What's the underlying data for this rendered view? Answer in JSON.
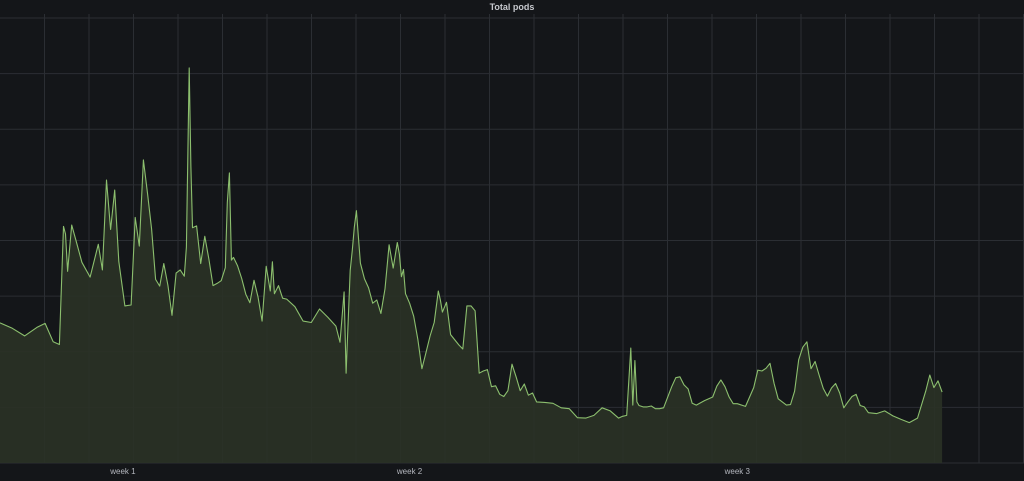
{
  "panel": {
    "title": "Total pods"
  },
  "colors": {
    "background": "#141619",
    "grid": "#2b2e33",
    "line": "#8cbf6e",
    "fill": "#2a3226"
  },
  "chart_data": {
    "type": "area",
    "title": "Total pods",
    "xlabel": "",
    "ylabel": "",
    "xlim": [
      0,
      25
    ],
    "ylim": [
      0,
      100
    ],
    "grid": true,
    "legend": "none",
    "x_tick_labels": [
      {
        "x": 3,
        "label": "week 1"
      },
      {
        "x": 10,
        "label": "week 2"
      },
      {
        "x": 18,
        "label": "week 3"
      }
    ],
    "series": [
      {
        "values": [
          [
            0.0,
            31.2
          ],
          [
            0.3,
            30.0
          ],
          [
            0.6,
            28.3
          ],
          [
            0.9,
            30.2
          ],
          [
            1.1,
            31.1
          ],
          [
            1.3,
            27.0
          ],
          [
            1.45,
            26.4
          ],
          [
            1.55,
            52.7
          ],
          [
            1.6,
            51.0
          ],
          [
            1.65,
            42.7
          ],
          [
            1.75,
            53.0
          ],
          [
            1.85,
            49.7
          ],
          [
            2.0,
            44.7
          ],
          [
            2.2,
            41.4
          ],
          [
            2.4,
            48.7
          ],
          [
            2.5,
            43.0
          ],
          [
            2.6,
            63.0
          ],
          [
            2.7,
            52.0
          ],
          [
            2.8,
            60.8
          ],
          [
            2.9,
            44.9
          ],
          [
            3.05,
            35.0
          ],
          [
            3.2,
            35.2
          ],
          [
            3.3,
            54.7
          ],
          [
            3.4,
            48.3
          ],
          [
            3.5,
            67.5
          ],
          [
            3.6,
            60.1
          ],
          [
            3.7,
            52.1
          ],
          [
            3.8,
            40.9
          ],
          [
            3.9,
            39.4
          ],
          [
            4.0,
            44.4
          ],
          [
            4.1,
            39.6
          ],
          [
            4.2,
            32.9
          ],
          [
            4.3,
            42.3
          ],
          [
            4.4,
            43.0
          ],
          [
            4.5,
            41.6
          ],
          [
            4.55,
            48.1
          ],
          [
            4.62,
            88.0
          ],
          [
            4.66,
            66.0
          ],
          [
            4.7,
            52.4
          ],
          [
            4.8,
            52.8
          ],
          [
            4.9,
            44.4
          ],
          [
            5.0,
            50.5
          ],
          [
            5.1,
            45.4
          ],
          [
            5.2,
            39.5
          ],
          [
            5.3,
            40.0
          ],
          [
            5.4,
            40.6
          ],
          [
            5.5,
            43.5
          ],
          [
            5.55,
            58.0
          ],
          [
            5.6,
            64.6
          ],
          [
            5.65,
            45.2
          ],
          [
            5.7,
            45.8
          ],
          [
            5.8,
            43.9
          ],
          [
            5.9,
            41.1
          ],
          [
            6.0,
            37.6
          ],
          [
            6.1,
            35.7
          ],
          [
            6.2,
            40.7
          ],
          [
            6.3,
            37.0
          ],
          [
            6.4,
            31.6
          ],
          [
            6.5,
            43.8
          ],
          [
            6.6,
            38.3
          ],
          [
            6.65,
            44.8
          ],
          [
            6.7,
            37.7
          ],
          [
            6.8,
            39.5
          ],
          [
            6.9,
            36.7
          ],
          [
            7.0,
            36.5
          ],
          [
            7.2,
            34.8
          ],
          [
            7.4,
            31.6
          ],
          [
            7.6,
            31.3
          ],
          [
            7.8,
            34.3
          ],
          [
            8.0,
            32.5
          ],
          [
            8.2,
            30.5
          ],
          [
            8.3,
            26.9
          ],
          [
            8.4,
            38.1
          ],
          [
            8.45,
            20.0
          ],
          [
            8.55,
            42.9
          ],
          [
            8.6,
            47.4
          ],
          [
            8.65,
            52.5
          ],
          [
            8.7,
            56.2
          ],
          [
            8.8,
            44.5
          ],
          [
            8.9,
            41.0
          ],
          [
            9.0,
            39.0
          ],
          [
            9.1,
            35.6
          ],
          [
            9.2,
            36.3
          ],
          [
            9.3,
            33.3
          ],
          [
            9.4,
            38.8
          ],
          [
            9.5,
            48.6
          ],
          [
            9.6,
            43.4
          ],
          [
            9.7,
            49.1
          ],
          [
            9.75,
            46.5
          ],
          [
            9.8,
            41.5
          ],
          [
            9.85,
            43.1
          ],
          [
            9.9,
            37.7
          ],
          [
            10.0,
            35.6
          ],
          [
            10.1,
            32.7
          ],
          [
            10.2,
            27.6
          ],
          [
            10.3,
            21.0
          ],
          [
            10.4,
            24.6
          ],
          [
            10.5,
            28.3
          ],
          [
            10.6,
            31.3
          ],
          [
            10.7,
            38.3
          ],
          [
            10.75,
            36.4
          ],
          [
            10.8,
            33.6
          ],
          [
            10.9,
            35.8
          ],
          [
            11.0,
            28.6
          ],
          [
            11.2,
            26.3
          ],
          [
            11.3,
            25.4
          ],
          [
            11.4,
            35.0
          ],
          [
            11.5,
            35.0
          ],
          [
            11.6,
            33.9
          ],
          [
            11.7,
            20.0
          ],
          [
            11.8,
            20.5
          ],
          [
            11.9,
            20.8
          ],
          [
            12.0,
            17.0
          ],
          [
            12.1,
            17.2
          ],
          [
            12.2,
            15.3
          ],
          [
            12.3,
            14.8
          ],
          [
            12.4,
            16.1
          ],
          [
            12.5,
            22.0
          ],
          [
            12.6,
            19.2
          ],
          [
            12.7,
            16.1
          ],
          [
            12.8,
            17.6
          ],
          [
            12.9,
            15.1
          ],
          [
            13.0,
            15.6
          ],
          [
            13.1,
            13.6
          ],
          [
            13.3,
            13.5
          ],
          [
            13.5,
            13.3
          ],
          [
            13.7,
            12.3
          ],
          [
            13.9,
            12.1
          ],
          [
            14.1,
            10.1
          ],
          [
            14.3,
            10.0
          ],
          [
            14.5,
            10.6
          ],
          [
            14.7,
            12.3
          ],
          [
            14.9,
            11.6
          ],
          [
            15.1,
            10.0
          ],
          [
            15.2,
            10.4
          ],
          [
            15.3,
            10.6
          ],
          [
            15.4,
            25.6
          ],
          [
            15.45,
            12.9
          ],
          [
            15.5,
            22.8
          ],
          [
            15.55,
            13.6
          ],
          [
            15.6,
            12.8
          ],
          [
            15.7,
            12.5
          ],
          [
            15.8,
            12.5
          ],
          [
            15.9,
            12.7
          ],
          [
            16.0,
            12.1
          ],
          [
            16.1,
            12.1
          ],
          [
            16.2,
            12.3
          ],
          [
            16.4,
            17.0
          ],
          [
            16.5,
            19.0
          ],
          [
            16.6,
            19.2
          ],
          [
            16.7,
            17.4
          ],
          [
            16.8,
            16.5
          ],
          [
            16.9,
            13.3
          ],
          [
            17.0,
            12.9
          ],
          [
            17.2,
            13.9
          ],
          [
            17.4,
            14.7
          ],
          [
            17.5,
            17.1
          ],
          [
            17.6,
            18.5
          ],
          [
            17.7,
            17.0
          ],
          [
            17.8,
            14.7
          ],
          [
            17.9,
            13.2
          ],
          [
            18.0,
            13.2
          ],
          [
            18.2,
            12.6
          ],
          [
            18.4,
            16.8
          ],
          [
            18.5,
            20.7
          ],
          [
            18.6,
            20.5
          ],
          [
            18.7,
            21.1
          ],
          [
            18.8,
            22.2
          ],
          [
            18.9,
            17.7
          ],
          [
            19.0,
            14.3
          ],
          [
            19.1,
            13.6
          ],
          [
            19.2,
            12.9
          ],
          [
            19.3,
            13.0
          ],
          [
            19.4,
            16.0
          ],
          [
            19.5,
            23.0
          ],
          [
            19.6,
            25.8
          ],
          [
            19.7,
            27.0
          ],
          [
            19.8,
            21.0
          ],
          [
            19.9,
            22.6
          ],
          [
            20.0,
            19.5
          ],
          [
            20.1,
            16.6
          ],
          [
            20.2,
            14.9
          ],
          [
            20.3,
            16.7
          ],
          [
            20.4,
            17.7
          ],
          [
            20.5,
            15.6
          ],
          [
            20.6,
            12.3
          ],
          [
            20.7,
            13.6
          ],
          [
            20.8,
            14.8
          ],
          [
            20.9,
            15.3
          ],
          [
            21.0,
            12.8
          ],
          [
            21.1,
            12.5
          ],
          [
            21.2,
            11.2
          ],
          [
            21.4,
            11.0
          ],
          [
            21.6,
            11.6
          ],
          [
            21.8,
            10.5
          ],
          [
            22.0,
            9.7
          ],
          [
            22.2,
            9.0
          ],
          [
            22.4,
            10.0
          ],
          [
            22.6,
            16.0
          ],
          [
            22.7,
            19.6
          ],
          [
            22.8,
            16.8
          ],
          [
            22.9,
            18.3
          ],
          [
            23.0,
            15.8
          ]
        ]
      }
    ]
  }
}
